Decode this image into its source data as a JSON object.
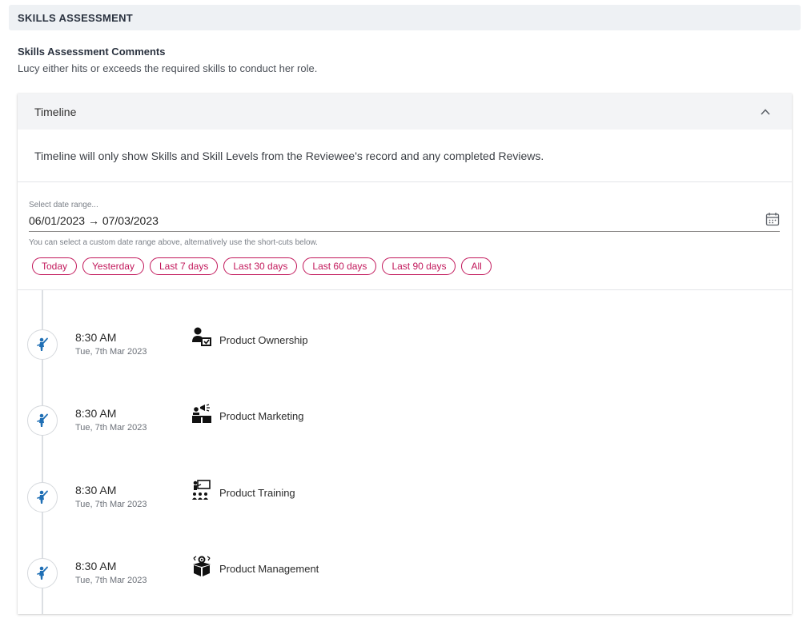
{
  "section": {
    "title": "SKILLS ASSESSMENT"
  },
  "comments": {
    "label": "Skills Assessment Comments",
    "text": "Lucy either hits or exceeds the required skills to conduct her role."
  },
  "timeline": {
    "header": "Timeline",
    "info": "Timeline will only show Skills and Skill Levels from the Reviewee's record and any completed Reviews.",
    "date_range": {
      "placeholder": "Select date range...",
      "value": "06/01/2023 → 07/03/2023",
      "help": "You can select a custom date range above, alternatively use the short-cuts below."
    },
    "shortcuts": [
      "Today",
      "Yesterday",
      "Last 7 days",
      "Last 30 days",
      "Last 60 days",
      "Last 90 days",
      "All"
    ],
    "entries": [
      {
        "time": "8:30 AM",
        "date": "Tue, 7th Mar 2023",
        "skill": "Product Ownership",
        "icon": "product-ownership-icon"
      },
      {
        "time": "8:30 AM",
        "date": "Tue, 7th Mar 2023",
        "skill": "Product Marketing",
        "icon": "product-marketing-icon"
      },
      {
        "time": "8:30 AM",
        "date": "Tue, 7th Mar 2023",
        "skill": "Product Training",
        "icon": "product-training-icon"
      },
      {
        "time": "8:30 AM",
        "date": "Tue, 7th Mar 2023",
        "skill": "Product Management",
        "icon": "product-management-icon"
      }
    ]
  },
  "colors": {
    "accent": "#c2185b",
    "marker_icon": "#1f6fb5",
    "header_bg": "#eef1f4"
  }
}
